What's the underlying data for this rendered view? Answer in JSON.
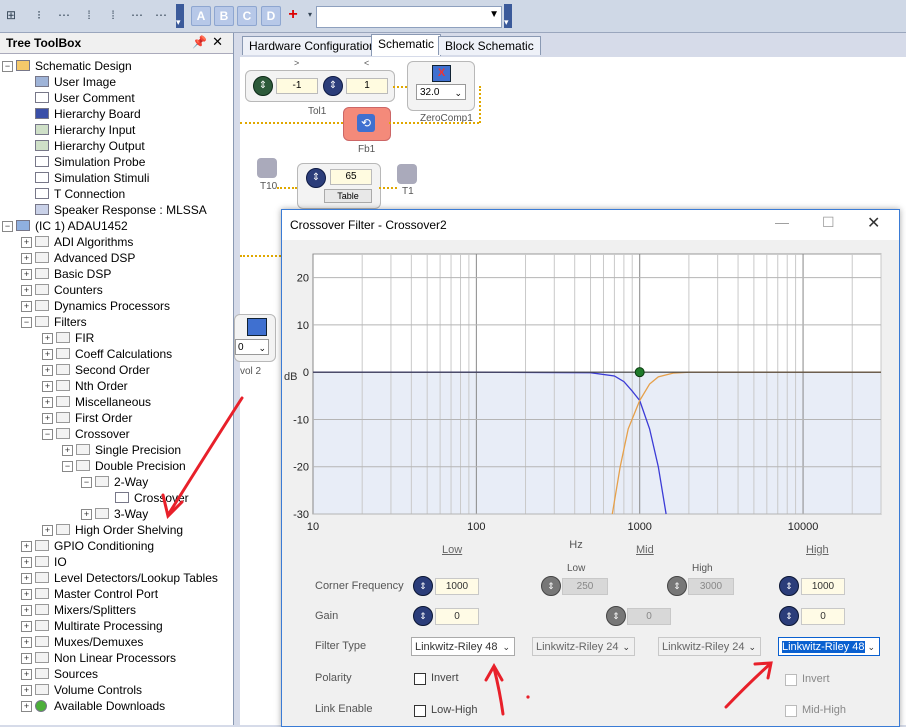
{
  "toolbar": {
    "letters": [
      "A",
      "B",
      "C",
      "D"
    ],
    "plus": "+",
    "combo_value": ""
  },
  "tree": {
    "title": "Tree ToolBox",
    "pin": "4",
    "close": "✕",
    "items": [
      {
        "label": "Schematic Design"
      },
      {
        "label": "User Image"
      },
      {
        "label": "User Comment"
      },
      {
        "label": "Hierarchy Board"
      },
      {
        "label": "Hierarchy Input"
      },
      {
        "label": "Hierarchy Output"
      },
      {
        "label": "Simulation Probe"
      },
      {
        "label": "Simulation Stimuli"
      },
      {
        "label": "T Connection"
      },
      {
        "label": "Speaker Response : MLSSA"
      },
      {
        "label": "(IC 1) ADAU1452"
      },
      {
        "label": "ADI Algorithms"
      },
      {
        "label": "Advanced DSP"
      },
      {
        "label": "Basic DSP"
      },
      {
        "label": "Counters"
      },
      {
        "label": "Dynamics Processors"
      },
      {
        "label": "Filters"
      },
      {
        "label": "FIR"
      },
      {
        "label": "Coeff Calculations"
      },
      {
        "label": "Second Order"
      },
      {
        "label": "Nth Order"
      },
      {
        "label": "Miscellaneous"
      },
      {
        "label": "First Order"
      },
      {
        "label": "Crossover"
      },
      {
        "label": "Single Precision"
      },
      {
        "label": "Double Precision"
      },
      {
        "label": "2-Way"
      },
      {
        "label": "Crossover"
      },
      {
        "label": "3-Way"
      },
      {
        "label": "High Order Shelving"
      },
      {
        "label": "GPIO Conditioning"
      },
      {
        "label": "IO"
      },
      {
        "label": "Level Detectors/Lookup Tables"
      },
      {
        "label": "Master Control Port"
      },
      {
        "label": "Mixers/Splitters"
      },
      {
        "label": "Multirate Processing"
      },
      {
        "label": "Muxes/Demuxes"
      },
      {
        "label": "Non Linear Processors"
      },
      {
        "label": "Sources"
      },
      {
        "label": "Volume Controls"
      },
      {
        "label": "Available Downloads"
      }
    ]
  },
  "tabs": [
    "Hardware Configuration",
    "Schematic",
    "Block Schematic"
  ],
  "schematic": {
    "tol_top_left": ">",
    "tol_top_right": "<",
    "tol_val1": "-1",
    "tol_val2": "1",
    "tol_label": "Tol1",
    "zc_value": "32.0",
    "zc_label": "ZeroComp1",
    "fb_label": "Fb1",
    "t10_label": "T10",
    "t1_label": "T1",
    "table_val": "65",
    "table_btn": "Table",
    "vol_value": "0",
    "vol_label": "vol 2"
  },
  "dialog": {
    "title": "Crossover Filter - Crossover2",
    "min": "—",
    "max": "☐",
    "close": "✕",
    "band_low": "Low",
    "band_mid": "Mid",
    "band_high": "High",
    "sub_low": "Low",
    "sub_high": "High",
    "row_corner": "Corner Frequency",
    "row_gain": "Gain",
    "row_filter": "Filter Type",
    "row_polarity": "Polarity",
    "row_link": "Link Enable",
    "low_corner": "1000",
    "mid_low_corner": "250",
    "mid_high_corner": "3000",
    "high_corner": "1000",
    "low_gain": "0",
    "mid_gain": "0",
    "high_gain": "0",
    "low_filter": "Linkwitz-Riley 48",
    "mid_low_filter": "Linkwitz-Riley 24",
    "mid_high_filter": "Linkwitz-Riley 24",
    "high_filter": "Linkwitz-Riley 48",
    "invert": "Invert",
    "low_high": "Low-High",
    "mid_high": "Mid-High"
  },
  "chart_data": {
    "type": "line",
    "title": "",
    "xlabel": "Hz",
    "ylabel": "dB",
    "xscale": "log",
    "xlim": [
      10,
      30000
    ],
    "ylim": [
      -30,
      25
    ],
    "xticks": [
      "10",
      "100",
      "1000",
      "10000"
    ],
    "yticks": [
      "20",
      "10",
      "0",
      "-10",
      "-20",
      "-30"
    ],
    "grid": true,
    "series": [
      {
        "color": "#3b3bd6",
        "x": [
          10,
          100,
          500,
          700,
          800,
          900,
          1000,
          1150,
          1300,
          1450
        ],
        "y": [
          0,
          0,
          -0.1,
          -0.8,
          -2,
          -4,
          -6,
          -12,
          -20,
          -30
        ]
      },
      {
        "color": "#e6a04a",
        "x": [
          680,
          760,
          850,
          1000,
          1150,
          1300,
          1600,
          2000,
          5000,
          30000
        ],
        "y": [
          -30,
          -20,
          -12,
          -6,
          -2.5,
          -1,
          -0.2,
          0,
          0,
          0
        ]
      }
    ],
    "marker": {
      "x": 1000,
      "y": 0
    }
  }
}
